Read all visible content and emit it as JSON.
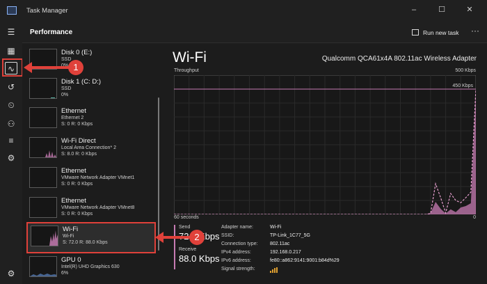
{
  "window": {
    "title": "Task Manager",
    "minimize_glyph": "–",
    "maximize_glyph": "☐",
    "close_glyph": "✕"
  },
  "header": {
    "title": "Performance",
    "run_new_task": "Run new task",
    "more_glyph": "···"
  },
  "rail_icons": [
    "hamburger-icon",
    "processes-icon",
    "performance-icon",
    "app-history-icon",
    "startup-apps-icon",
    "users-icon",
    "details-icon",
    "services-icon",
    "settings-icon"
  ],
  "devices": [
    {
      "name": "Disk 0 (E:)",
      "sub1": "SSD",
      "sub2": "0%",
      "selected": false
    },
    {
      "name": "Disk 1 (C: D:)",
      "sub1": "SSD",
      "sub2": "0%",
      "selected": false
    },
    {
      "name": "Ethernet",
      "sub1": "Ethernet 2",
      "sub2": "S: 0 R: 0 Kbps",
      "selected": false
    },
    {
      "name": "Wi-Fi Direct",
      "sub1": "Local Area Connection* 2",
      "sub2": "S: 8.0 R: 0 Kbps",
      "selected": false
    },
    {
      "name": "Ethernet",
      "sub1": "VMware Network Adapter VMnet1",
      "sub2": "S: 0 R: 0 Kbps",
      "selected": false
    },
    {
      "name": "Ethernet",
      "sub1": "VMware Network Adapter VMnet8",
      "sub2": "S: 0 R: 0 Kbps",
      "selected": false
    },
    {
      "name": "Wi-Fi",
      "sub1": "Wi-Fi",
      "sub2": "S: 72.0 R: 88.0 Kbps",
      "selected": true
    },
    {
      "name": "GPU 0",
      "sub1": "Intel(R) UHD Graphics 630",
      "sub2": "6%",
      "selected": false
    }
  ],
  "main": {
    "title": "Wi-Fi",
    "adapter": "Qualcomm QCA61x4A 802.11ac Wireless Adapter",
    "throughput_label": "Throughput",
    "max_label": "500 Kbps",
    "line_label": "450 Kbps",
    "x_left": "60 seconds",
    "x_right": "0",
    "send_label": "Send",
    "send_value": "72.0 Kbps",
    "receive_label": "Receive",
    "receive_value": "88.0 Kbps"
  },
  "details": [
    {
      "k": "Adapter name:",
      "v": "Wi-Fi"
    },
    {
      "k": "SSID:",
      "v": "TP-Link_1C77_5G"
    },
    {
      "k": "Connection type:",
      "v": "802.11ac"
    },
    {
      "k": "IPv4 address:",
      "v": "192.168.0.217"
    },
    {
      "k": "IPv6 address:",
      "v": "fe80::a862:9141:9001:b84d%29"
    },
    {
      "k": "Signal strength:",
      "v": ""
    }
  ],
  "callouts": {
    "one": "1",
    "two": "2"
  },
  "colors": {
    "accent": "#c77bb3",
    "callout": "#e0413a",
    "signal": "#e0a030"
  },
  "chart_data": {
    "type": "area",
    "ylim": [
      0,
      500
    ],
    "reference_line": 450,
    "series": [
      {
        "values": [
          0,
          0,
          0,
          0,
          0,
          0,
          0,
          0,
          0,
          0,
          0,
          0,
          0,
          0,
          0,
          0,
          0,
          0,
          0,
          0,
          0,
          0,
          0,
          0,
          0,
          0,
          0,
          0,
          0,
          0,
          0,
          0,
          0,
          0,
          0,
          0,
          0,
          0,
          0,
          0,
          0,
          0,
          0,
          0,
          0,
          0,
          0,
          0,
          0,
          0,
          0,
          5,
          45,
          20,
          3,
          18,
          8,
          25,
          30,
          40,
          430
        ]
      },
      {
        "values": [
          0,
          0,
          0,
          0,
          0,
          0,
          0,
          0,
          0,
          0,
          0,
          0,
          0,
          0,
          0,
          0,
          0,
          0,
          0,
          0,
          0,
          0,
          0,
          0,
          0,
          0,
          0,
          0,
          0,
          0,
          0,
          0,
          0,
          0,
          0,
          0,
          0,
          0,
          0,
          0,
          0,
          0,
          0,
          0,
          0,
          0,
          0,
          0,
          0,
          0,
          0,
          3,
          110,
          60,
          5,
          75,
          50,
          42,
          60,
          80,
          450
        ]
      }
    ]
  }
}
